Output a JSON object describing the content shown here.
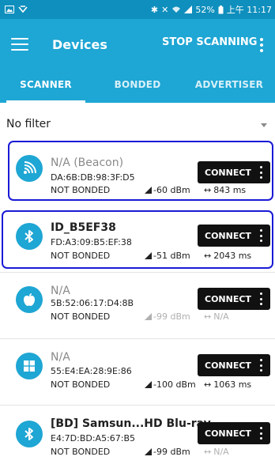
{
  "status_bar": {
    "left_icons": [
      "gallery-icon",
      "notification-icon"
    ],
    "right_icons": [
      "bluetooth-icon",
      "mute-icon",
      "wifi-icon",
      "signal-icon"
    ],
    "battery": "52%",
    "time": "上午 11:17"
  },
  "app_bar": {
    "title": "Devices",
    "stop_label": "STOP SCANNING"
  },
  "tabs": [
    {
      "label": "SCANNER",
      "active": true
    },
    {
      "label": "BONDED",
      "active": false
    },
    {
      "label": "ADVERTISER",
      "active": false
    }
  ],
  "filter": {
    "label": "No filter"
  },
  "colors": {
    "primary": "#1ea6d4",
    "status_bar": "#0f8fbd",
    "highlight": "#1a1ad6",
    "connect": "#111111"
  },
  "devices": [
    {
      "name": "N/A  (Beacon)",
      "address": "DA:6B:DB:98:3F:D5",
      "bond": "NOT BONDED",
      "rssi": "-60 dBm",
      "interval": "843 ms",
      "icon": "beacon-icon",
      "connect": "CONNECT"
    },
    {
      "name": "ID_B5EF38",
      "address": "FD:A3:09:B5:EF:38",
      "bond": "NOT BONDED",
      "rssi": "-51 dBm",
      "interval": "2043 ms",
      "icon": "bluetooth-icon",
      "connect": "CONNECT"
    },
    {
      "name": "N/A",
      "address": "5B:52:06:17:D4:8B",
      "bond": "NOT BONDED",
      "rssi": "-99 dBm",
      "interval": "N/A",
      "icon": "apple-icon",
      "connect": "CONNECT"
    },
    {
      "name": "N/A",
      "address": "55:E4:EA:28:9E:86",
      "bond": "NOT BONDED",
      "rssi": "-100 dBm",
      "interval": "1063 ms",
      "icon": "windows-icon",
      "connect": "CONNECT"
    },
    {
      "name": "[BD] Samsun...HD Blu-ray",
      "address": "E4:7D:BD:A5:67:B5",
      "bond": "NOT BONDED",
      "rssi": "-99 dBm",
      "interval": "N/A",
      "icon": "bluetooth-icon",
      "connect": "CONNECT"
    }
  ]
}
